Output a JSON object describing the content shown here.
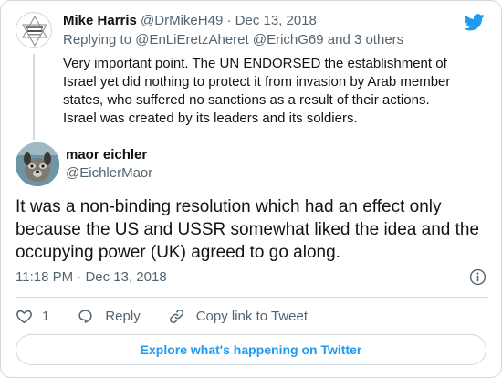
{
  "parent_tweet": {
    "name": "Mike Harris",
    "handle": "@DrMikeH49",
    "separator": "·",
    "date": "Dec 13, 2018",
    "replying_prefix": "Replying to",
    "replying_handles": "@EnLiEretzAheret @ErichG69",
    "replying_suffix": "and 3 others",
    "text": "Very important point. The UN ENDORSED the establishment of Israel yet did nothing to protect it from invasion by Arab member states, who suffered no sanctions as a result of their actions. Israel was created by its leaders and its soldiers.",
    "avatar_icon": "star-of-david-avatar"
  },
  "main_tweet": {
    "name": "maor eichler",
    "handle": "@EichlerMaor",
    "text": "It was a non-binding resolution which had an effect only because the US and USSR somewhat liked the idea and the occupying power (UK) agreed to go along.",
    "time": "11:18 PM",
    "separator": "·",
    "date": "Dec 13, 2018",
    "avatar_icon": "dog-photo-avatar"
  },
  "actions": {
    "like_count": "1",
    "reply_label": "Reply",
    "copy_link_label": "Copy link to Tweet"
  },
  "explore_label": "Explore what's happening on Twitter",
  "colors": {
    "brand_blue": "#1d9bf0",
    "text": "#0f1419",
    "muted": "#536471",
    "border": "#cfd9de"
  }
}
